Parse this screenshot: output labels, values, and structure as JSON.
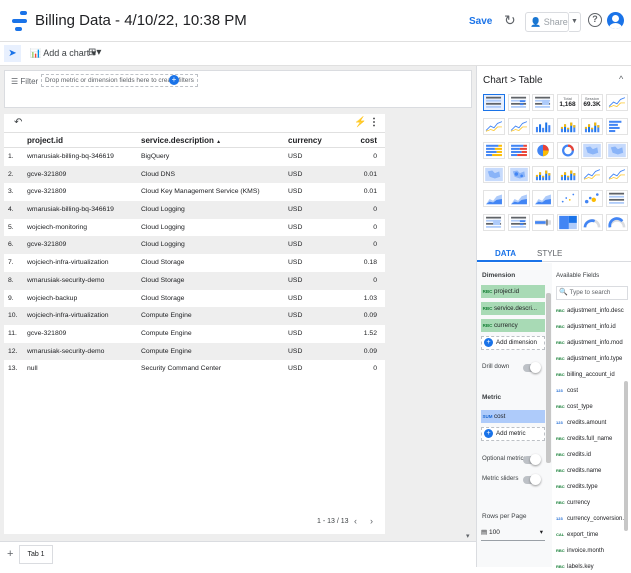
{
  "header": {
    "title": "Billing Data - 4/10/22, 10:38 PM",
    "save_label": "Save",
    "refresh_icon": "↻",
    "share_label": "Share",
    "help_icon": "?"
  },
  "toolbar": {
    "add_chart_label": "Add a chart",
    "add_control_icon": "⊞"
  },
  "filter": {
    "label": "Filter",
    "drop_hint": "Drop metric or dimension fields here to create filters",
    "add_icon": "+"
  },
  "table": {
    "columns": [
      "project.id",
      "service.description",
      "currency",
      "cost"
    ],
    "sort_indicator": "▲",
    "rows": [
      {
        "num": "1.",
        "project": "wmarusiak-billing-bq-346619",
        "service": "BigQuery",
        "currency": "USD",
        "cost": "0"
      },
      {
        "num": "2.",
        "project": "gcve-321809",
        "service": "Cloud DNS",
        "currency": "USD",
        "cost": "0.01"
      },
      {
        "num": "3.",
        "project": "gcve-321809",
        "service": "Cloud Key Management Service (KMS)",
        "currency": "USD",
        "cost": "0.01"
      },
      {
        "num": "4.",
        "project": "wmarusiak-billing-bq-346619",
        "service": "Cloud Logging",
        "currency": "USD",
        "cost": "0"
      },
      {
        "num": "5.",
        "project": "wojciech-monitoring",
        "service": "Cloud Logging",
        "currency": "USD",
        "cost": "0"
      },
      {
        "num": "6.",
        "project": "gcve-321809",
        "service": "Cloud Logging",
        "currency": "USD",
        "cost": "0"
      },
      {
        "num": "7.",
        "project": "wojciech-infra-virtualization",
        "service": "Cloud Storage",
        "currency": "USD",
        "cost": "0.18"
      },
      {
        "num": "8.",
        "project": "wmarusiak-security-demo",
        "service": "Cloud Storage",
        "currency": "USD",
        "cost": "0"
      },
      {
        "num": "9.",
        "project": "wojciech-backup",
        "service": "Cloud Storage",
        "currency": "USD",
        "cost": "1.03"
      },
      {
        "num": "10.",
        "project": "wojciech-infra-virtualization",
        "service": "Compute Engine",
        "currency": "USD",
        "cost": "0.09"
      },
      {
        "num": "11.",
        "project": "gcve-321809",
        "service": "Compute Engine",
        "currency": "USD",
        "cost": "1.52"
      },
      {
        "num": "12.",
        "project": "wmarusiak-security-demo",
        "service": "Compute Engine",
        "currency": "USD",
        "cost": "0.09"
      },
      {
        "num": "13.",
        "project": "null",
        "service": "Security Command Center",
        "currency": "USD",
        "cost": "0"
      }
    ],
    "pagination": "1 - 13 / 13",
    "prev_icon": "‹",
    "next_icon": "›"
  },
  "pages": {
    "add_icon": "+",
    "tabs": [
      "Tab 1"
    ]
  },
  "panel": {
    "breadcrumb": "Chart > Table",
    "collapse_icon": "^",
    "scorecard_labels": [
      "Total",
      "Session"
    ],
    "scorecard_values": [
      "1,168",
      "69.3K"
    ],
    "tabs": {
      "data": "DATA",
      "style": "STYLE"
    },
    "dimension": {
      "label": "Dimension",
      "chips": [
        {
          "type": "RBC",
          "name": "project.id"
        },
        {
          "type": "RBC",
          "name": "service.descri..."
        },
        {
          "type": "RBC",
          "name": "currency"
        }
      ],
      "add_label": "Add dimension"
    },
    "drill_down_label": "Drill down",
    "metric": {
      "label": "Metric",
      "chips": [
        {
          "type": "SUM",
          "name": "cost"
        }
      ],
      "add_label": "Add metric"
    },
    "optional_metrics_label": "Optional metrics",
    "metric_sliders_label": "Metric sliders",
    "rows_per_page": {
      "label": "Rows per Page",
      "value": "100"
    },
    "available_fields": {
      "title": "Available Fields",
      "search_placeholder": "Type to search",
      "fields": [
        {
          "type": "RBC",
          "name": "adjustment_info.desc"
        },
        {
          "type": "RBC",
          "name": "adjustment_info.id"
        },
        {
          "type": "RBC",
          "name": "adjustment_info.mod"
        },
        {
          "type": "RBC",
          "name": "adjustment_info.type"
        },
        {
          "type": "RBC",
          "name": "billing_account_id"
        },
        {
          "type": "123",
          "name": "cost"
        },
        {
          "type": "RBC",
          "name": "cost_type"
        },
        {
          "type": "123",
          "name": "credits.amount"
        },
        {
          "type": "RBC",
          "name": "credits.full_name"
        },
        {
          "type": "RBC",
          "name": "credits.id"
        },
        {
          "type": "RBC",
          "name": "credits.name"
        },
        {
          "type": "RBC",
          "name": "credits.type"
        },
        {
          "type": "RBC",
          "name": "currency"
        },
        {
          "type": "123",
          "name": "currency_conversion..."
        },
        {
          "type": "CAL",
          "name": "export_time"
        },
        {
          "type": "RBC",
          "name": "invoice.month"
        },
        {
          "type": "RBC",
          "name": "labels.key"
        }
      ]
    }
  }
}
